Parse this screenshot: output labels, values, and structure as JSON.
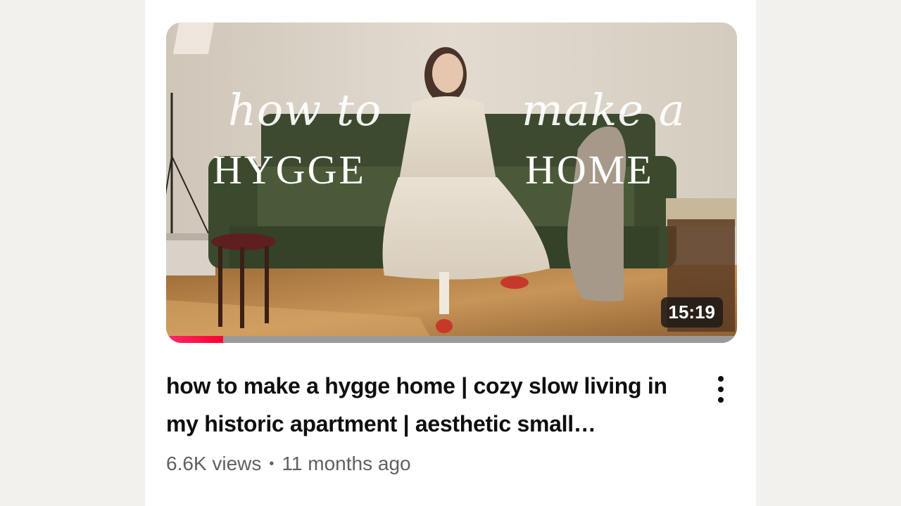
{
  "video": {
    "thumbnail": {
      "overlay_script_left": "how to",
      "overlay_script_right": "make a",
      "overlay_caps_left": "HYGGE",
      "overlay_caps_right": "HOME",
      "duration": "15:19",
      "watched_fraction": 0.1
    },
    "title": "how to make a hygge home | cozy slow living in my historic apartment | aesthetic small…",
    "views": "6.6K views",
    "separator": "•",
    "age": "11 months ago",
    "menu_icon": "more-vert-icon"
  },
  "colors": {
    "progress": "#ff0033",
    "background": "#f2f1ee",
    "card": "#ffffff"
  }
}
